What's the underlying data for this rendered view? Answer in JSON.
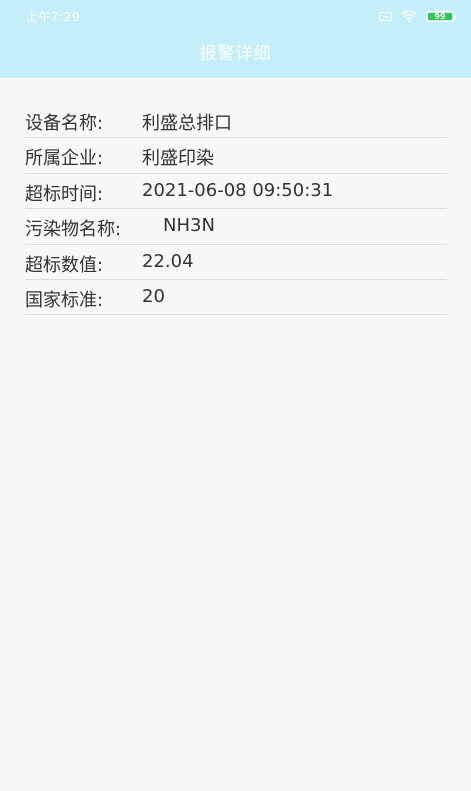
{
  "status_bar": {
    "time": "上午7:29",
    "battery_level": "99"
  },
  "header": {
    "title": "报警详细"
  },
  "details": [
    {
      "label": "设备名称:",
      "value": "利盛总排口"
    },
    {
      "label": "所属企业:",
      "value": "利盛印染"
    },
    {
      "label": "超标时间:",
      "value": "2021-06-08 09:50:31"
    },
    {
      "label": "污染物名称:",
      "value": "NH3N"
    },
    {
      "label": "超标数值:",
      "value": "22.04"
    },
    {
      "label": "国家标准:",
      "value": "20"
    }
  ],
  "colors": {
    "header_bg": "#c4eef9",
    "page_bg": "#f8f8f8",
    "text": "#333333",
    "divider": "#dcdcdc",
    "battery": "#35c259"
  },
  "icons": [
    "sim-icon",
    "wifi-icon",
    "battery-icon"
  ]
}
